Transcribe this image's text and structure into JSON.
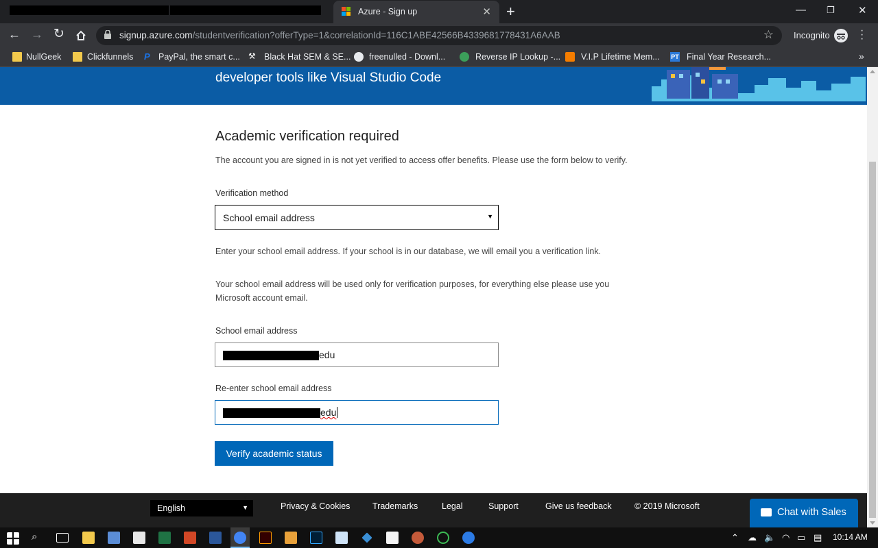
{
  "browser": {
    "active_tab_title": "Azure - Sign up",
    "url_host": "signup.azure.com",
    "url_path": "/studentverification?offerType=1&correlationId=116C1ABE42566B4339681778431A6AAB",
    "incognito_label": "Incognito",
    "bookmarks": [
      {
        "label": "NullGeek",
        "icon": "folder-icon"
      },
      {
        "label": "Clickfunnels",
        "icon": "folder-icon"
      },
      {
        "label": "PayPal, the smart c...",
        "icon": "paypal-icon"
      },
      {
        "label": "Black Hat SEM & SE...",
        "icon": "blackhat-icon"
      },
      {
        "label": "freenulled - Downl...",
        "icon": "globe-icon"
      },
      {
        "label": "Reverse IP Lookup -...",
        "icon": "globe-icon"
      },
      {
        "label": "V.I.P Lifetime Mem...",
        "icon": "blogger-icon"
      },
      {
        "label": "Final Year Research...",
        "icon": "pt-icon"
      }
    ]
  },
  "hero": {
    "text": "developer tools like Visual Studio Code"
  },
  "form": {
    "heading": "Academic verification required",
    "intro": "The account you are signed in is not yet verified to access offer benefits. Please use the form below to verify.",
    "method_label": "Verification method",
    "method_value": "School email address",
    "help_1": "Enter your school email address. If your school is in our database, we will email you a verification link.",
    "help_2": "Your school email address will be used only for verification purposes, for everything else please use you Microsoft account email.",
    "email_label": "School email address",
    "email_suffix": "edu",
    "reenter_label": "Re-enter school email address",
    "reenter_suffix": "edu",
    "submit_label": "Verify academic status"
  },
  "footer": {
    "language": "English",
    "links": [
      "Privacy & Cookies",
      "Trademarks",
      "Legal",
      "Support",
      "Give us feedback",
      "© 2019 Microsoft"
    ],
    "chat_label": "Chat with Sales"
  },
  "taskbar": {
    "time": "10:14 AM"
  },
  "colors": {
    "brand_blue": "#0067b8",
    "hero_blue": "#0b5ca5"
  }
}
